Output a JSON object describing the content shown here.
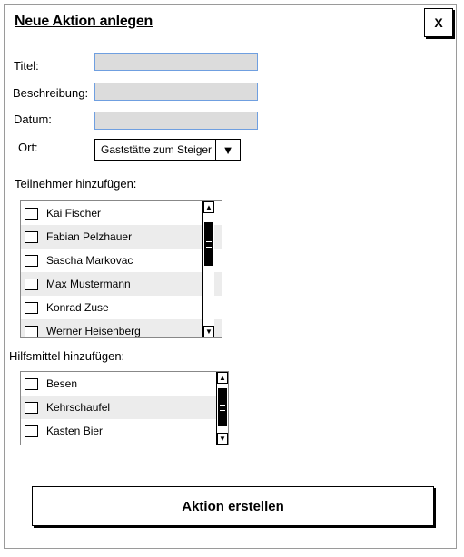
{
  "dialog": {
    "title": "Neue Aktion anlegen",
    "close_label": "X"
  },
  "form": {
    "titel_label": "Titel:",
    "beschreibung_label": "Beschreibung:",
    "datum_label": "Datum:",
    "ort_label": "Ort:",
    "ort_value": "Gaststätte zum Steiger",
    "ort_arrow": "▼"
  },
  "teilnehmer": {
    "label": "Teilnehmer hinzufügen:",
    "items": [
      {
        "label": "Kai Fischer"
      },
      {
        "label": "Fabian Pelzhauer"
      },
      {
        "label": "Sascha Markovac"
      },
      {
        "label": "Max Mustermann"
      },
      {
        "label": "Konrad Zuse"
      },
      {
        "label": "Werner Heisenberg"
      }
    ]
  },
  "hilfsmittel": {
    "label": "Hilfsmittel hinzufügen:",
    "items": [
      {
        "label": "Besen"
      },
      {
        "label": "Kehrschaufel"
      },
      {
        "label": "Kasten Bier"
      }
    ]
  },
  "scroll": {
    "up_glyph": "▲",
    "down_glyph": "▼"
  },
  "actions": {
    "submit_label": "Aktion erstellen"
  }
}
